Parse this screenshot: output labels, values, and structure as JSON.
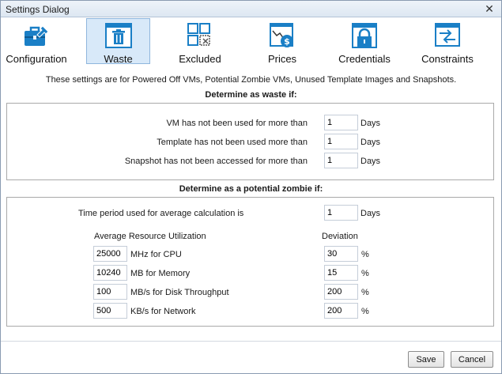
{
  "window": {
    "title": "Settings Dialog",
    "close_glyph": "✕"
  },
  "toolbar": {
    "items": [
      {
        "label": "Configuration",
        "icon": "briefcase-wrench-icon"
      },
      {
        "label": "Waste",
        "icon": "trash-window-icon"
      },
      {
        "label": "Excluded",
        "icon": "grid-excluded-icon"
      },
      {
        "label": "Prices",
        "icon": "price-chart-icon"
      },
      {
        "label": "Credentials",
        "icon": "padlock-icon"
      },
      {
        "label": "Constraints",
        "icon": "arrows-window-icon"
      }
    ],
    "active_index": 1
  },
  "info_text": "These settings are for Powered Off VMs, Potential Zombie VMs, Unused Template Images and Snapshots.",
  "waste": {
    "heading": "Determine as waste if:",
    "rows": [
      {
        "label": "VM has not been used for more than",
        "value": "1",
        "unit": "Days"
      },
      {
        "label": "Template has not been used more than",
        "value": "1",
        "unit": "Days"
      },
      {
        "label": "Snapshot has not been accessed for more than",
        "value": "1",
        "unit": "Days"
      }
    ]
  },
  "zombie": {
    "heading": "Determine as a potential zombie if:",
    "period_label": "Time period used for average calculation is",
    "period_value": "1",
    "period_unit": "Days",
    "util_header": "Average Resource Utilization",
    "dev_header": "Deviation",
    "rows": [
      {
        "value": "25000",
        "label": "MHz for CPU",
        "deviation": "30",
        "unit": "%"
      },
      {
        "value": "10240",
        "label": "MB for Memory",
        "deviation": "15",
        "unit": "%"
      },
      {
        "value": "100",
        "label": "MB/s for Disk Throughput",
        "deviation": "200",
        "unit": "%"
      },
      {
        "value": "500",
        "label": "KB/s for Network",
        "deviation": "200",
        "unit": "%"
      }
    ]
  },
  "buttons": {
    "save": "Save",
    "cancel": "Cancel"
  },
  "colors": {
    "accent": "#1a7fc6",
    "active_tab": "#d8e9f9"
  }
}
